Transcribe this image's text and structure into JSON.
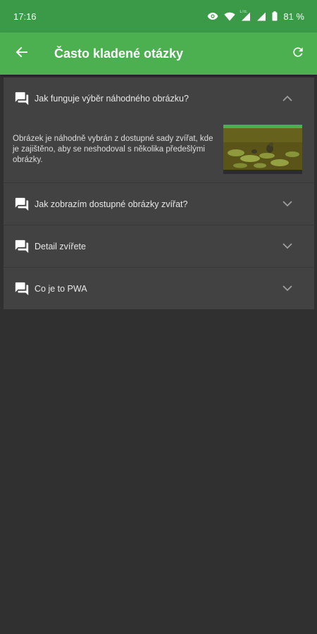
{
  "status_bar": {
    "time": "17:16",
    "network_label": "LTE",
    "battery": "81 %"
  },
  "app_bar": {
    "title": "Často kladené otázky",
    "back_icon": "arrow-back-icon",
    "refresh_icon": "refresh-icon"
  },
  "faq": {
    "items": [
      {
        "question": "Jak funguje výběr náhodného obrázku?",
        "expanded": true,
        "answer": "Obrázek je náhodně vybrán z dostupné sady zvířat, kde je zajištěno, aby se neshodoval s několika předešlými obrázky."
      },
      {
        "question": "Jak zobrazím dostupné obrázky zvířat?",
        "expanded": false
      },
      {
        "question": "Detail zvířete",
        "expanded": false
      },
      {
        "question": "Co je to PWA",
        "expanded": false
      }
    ]
  },
  "colors": {
    "status_bar": "#3b9a47",
    "app_bar": "#4caf50",
    "background": "#303030",
    "card": "#424242"
  }
}
